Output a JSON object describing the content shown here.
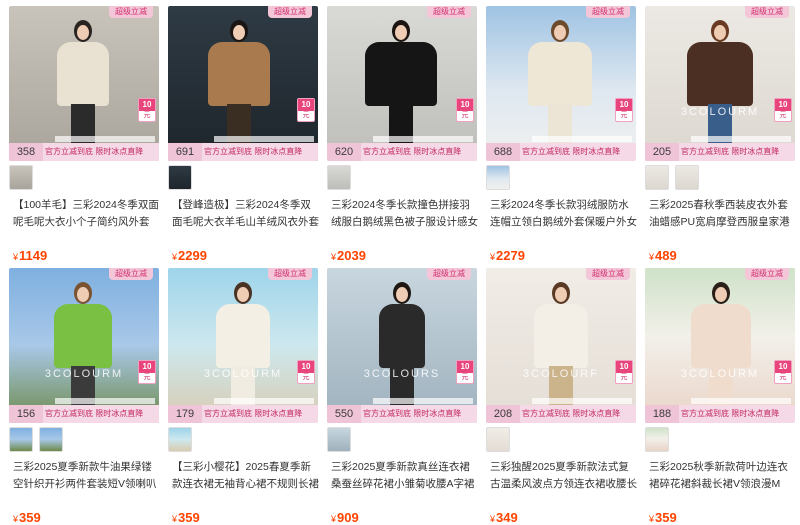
{
  "strip_label": "官方立减到底 限时冰点直降",
  "tag": {
    "top": "10",
    "bottom": "元"
  },
  "products": [
    {
      "badge": "超级立减",
      "count": "358",
      "title": "【100羊毛】三彩2024冬季双面呢毛呢大衣小个子简约风外套",
      "price": "1149",
      "thumbs": 1,
      "watermark": ""
    },
    {
      "badge": "超级立减",
      "count": "691",
      "title": "【登峰造极】三彩2024冬季双面毛呢大衣羊毛山羊绒风衣外套女",
      "price": "2299",
      "thumbs": 1,
      "watermark": ""
    },
    {
      "badge": "超级立减",
      "count": "620",
      "title": "三彩2024冬季长款撞色拼接羽绒服白鹅绒黑色被子服设计感女",
      "price": "2039",
      "thumbs": 1,
      "watermark": ""
    },
    {
      "badge": "超级立减",
      "count": "688",
      "title": "三彩2024冬季长款羽绒服防水连帽立领白鹅绒外套保暖户外女",
      "price": "2279",
      "thumbs": 1,
      "watermark": ""
    },
    {
      "badge": "超级立减",
      "count": "205",
      "title": "三彩2025春秋季西装皮衣外套油蜡感PU宽肩摩登西服皇家港",
      "price": "489",
      "thumbs": 2,
      "watermark": "3COLOURM"
    },
    {
      "badge": "超级立减",
      "count": "156",
      "title": "三彩2025夏季新款牛油果绿镂空针织开衫两件套装短V领喇叭",
      "price": "359",
      "thumbs": 2,
      "watermark": "3COLOURM"
    },
    {
      "badge": "超级立减",
      "count": "179",
      "title": "【三彩小樱花】2025春夏季新款连衣裙无袖背心裙不规则长裙",
      "price": "359",
      "thumbs": 1,
      "watermark": "3COLOURM"
    },
    {
      "badge": "超级立减",
      "count": "550",
      "title": "三彩2025夏季新款真丝连衣裙桑蚕丝碎花裙小雏菊收腰A字裙",
      "price": "909",
      "thumbs": 1,
      "watermark": "3COLOURS"
    },
    {
      "badge": "超级立减",
      "count": "208",
      "title": "三彩独醒2025夏季新款法式复古温柔风波点方领连衣裙收腰长",
      "price": "349",
      "thumbs": 1,
      "watermark": "3COLOURF"
    },
    {
      "badge": "超级立减",
      "count": "188",
      "title": "三彩2025秋季新款荷叶边连衣裙碎花裙斜裁长裙V领浪漫M",
      "price": "359",
      "thumbs": 1,
      "watermark": "3COLOURM"
    }
  ],
  "currency": "¥"
}
